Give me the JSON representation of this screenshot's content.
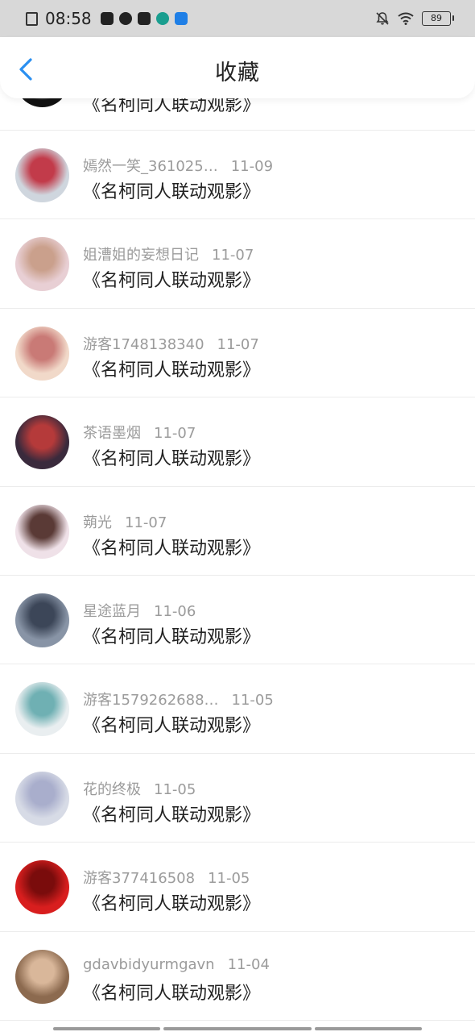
{
  "status_bar": {
    "time": "08:58",
    "battery": "89",
    "icons": [
      "sim-off-icon",
      "app-notification-icon",
      "compass-icon",
      "video-app-icon",
      "l-app-icon",
      "blue-app-icon",
      "mute-bell-icon",
      "wifi-icon",
      "battery-icon"
    ]
  },
  "header": {
    "title": "收藏",
    "back_icon": "chevron-left-icon",
    "accent": "#2a8ff1"
  },
  "favorites": [
    {
      "user": "",
      "date": "",
      "title": "《名柯同人联动观影》",
      "avatar_colors": [
        "#111111",
        "#ffffff"
      ]
    },
    {
      "user": "嫣然一笑_361025…",
      "date": "11-09",
      "title": "《名柯同人联动观影》",
      "avatar_colors": [
        "#cfd6de",
        "#c23b4a"
      ]
    },
    {
      "user": "姐漕姐的妄想日记",
      "date": "11-07",
      "title": "《名柯同人联动观影》",
      "avatar_colors": [
        "#e8cfd4",
        "#caa08c"
      ]
    },
    {
      "user": "游客1748138340",
      "date": "11-07",
      "title": "《名柯同人联动观影》",
      "avatar_colors": [
        "#f1d9c9",
        "#c97a76"
      ]
    },
    {
      "user": "茶语墨烟",
      "date": "11-07",
      "title": "《名柯同人联动观影》",
      "avatar_colors": [
        "#3a2a3c",
        "#b53a3a"
      ]
    },
    {
      "user": "蒴光",
      "date": "11-07",
      "title": "《名柯同人联动观影》",
      "avatar_colors": [
        "#efe1e8",
        "#5a3a36"
      ]
    },
    {
      "user": "星途蓝月",
      "date": "11-06",
      "title": "《名柯同人联动观影》",
      "avatar_colors": [
        "#8894a6",
        "#3c4658"
      ]
    },
    {
      "user": "游客1579262688…",
      "date": "11-05",
      "title": "《名柯同人联动观影》",
      "avatar_colors": [
        "#e9eef0",
        "#6fb0b3"
      ]
    },
    {
      "user": "花的终极",
      "date": "11-05",
      "title": "《名柯同人联动观影》",
      "avatar_colors": [
        "#d7dbe6",
        "#a9aecc"
      ]
    },
    {
      "user": "游客377416508",
      "date": "11-05",
      "title": "《名柯同人联动观影》",
      "avatar_colors": [
        "#d81e1e",
        "#7a0c0c"
      ]
    },
    {
      "user": "gdavbidyurmgavn",
      "date": "11-04",
      "title": "《名柯同人联动观影》",
      "avatar_colors": [
        "#8c6a4f",
        "#d9b79a"
      ]
    }
  ]
}
